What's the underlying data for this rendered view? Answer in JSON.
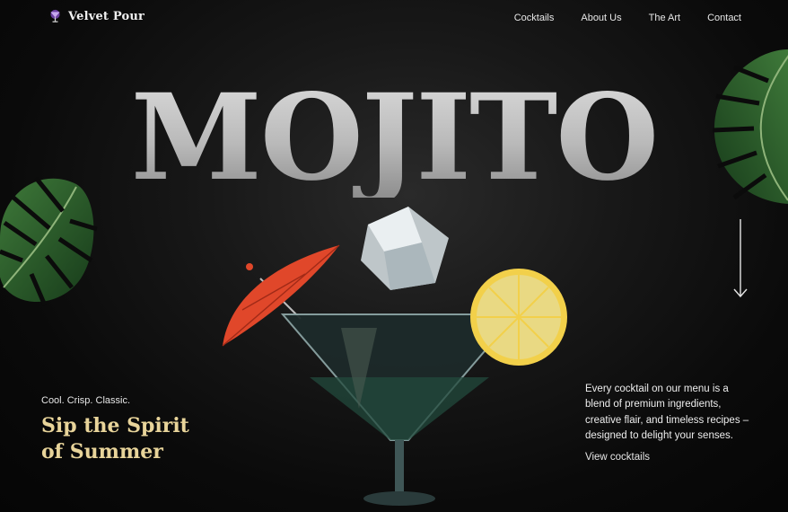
{
  "brand": {
    "name": "Velvet Pour",
    "logo_icon": "cocktail-glass-icon"
  },
  "nav": {
    "links": [
      "Cocktails",
      "About Us",
      "The Art",
      "Contact"
    ]
  },
  "hero": {
    "title": "MOJITO",
    "tagline_small": "Cool. Crisp. Classic.",
    "tagline_big_line1": "Sip the Spirit",
    "tagline_big_line2": "of Summer",
    "description": "Every cocktail on our menu is a blend of premium ingredients, creative flair, and timeless recipes – designed to delight your senses.",
    "cta": "View cocktails"
  },
  "icons": {
    "scroll": "arrow-down-icon",
    "leaf": "monstera-leaf-icon"
  },
  "colors": {
    "background": "#0b0b0b",
    "accent_gold": "#e8d49a",
    "title_silver": "#bdbdbd",
    "umbrella_red": "#e0472a",
    "lemon_yellow": "#f2d04a"
  }
}
